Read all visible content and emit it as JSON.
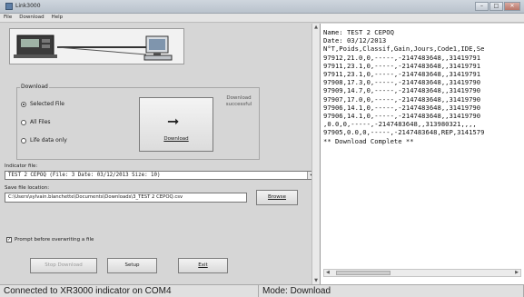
{
  "window": {
    "title": "Link3000",
    "minimize": "–",
    "maximize": "□",
    "close": "✕"
  },
  "menu": [
    "File",
    "Download",
    "Help"
  ],
  "download_group": {
    "title": "Download",
    "options": [
      {
        "label": "Selected File",
        "selected": true
      },
      {
        "label": "All Files",
        "selected": false
      },
      {
        "label": "Life data only",
        "selected": false
      }
    ],
    "button_label": "Download",
    "button_arrow": "➞",
    "status": "Download successful"
  },
  "indicator_file": {
    "label": "Indicator file:",
    "value": "TEST 2 CEPOQ          (File: 3  Date: 03/12/2013 Size: 10)",
    "dropdown_arrow": "▾"
  },
  "save_location": {
    "label": "Save file location:",
    "value": "C:\\Users\\sylvain.blanchette\\Documents\\Downloads\\3_TEST 2 CEPOQ.csv",
    "browse_label": "Browse"
  },
  "prompt_overwrite": {
    "label": "Prompt before overwriting a file",
    "checked": true,
    "check_mark": "✓"
  },
  "bottom_buttons": {
    "stop": "Stop Download",
    "setup": "Setup",
    "exit": "Exit"
  },
  "log_lines": [
    "Name: TEST 2 CEPOQ",
    "Date: 03/12/2013",
    "N°T,Poids,Classif,Gain,Jours,Code1,IDE,Se",
    "97912,21.0,0,-----,-2147483648,,31419791",
    "97911,23.1,0,-----,-2147483648,,31419791",
    "97911,23.1,0,-----,-2147483648,,31419791",
    "97908,17.3,0,-----,-2147483648,,31419790",
    "97909,14.7,0,-----,-2147483648,,31419790",
    "97907,17.0,0,-----,-2147483648,,31419790",
    "97906,14.1,0,-----,-2147483648,,31419790",
    "97906,14.1,0,-----,-2147483648,,31419790",
    ",0.0,0,-----,-2147483648,,313980321,,,,",
    "97905,0.0,0,-----,-2147483648,REP,3141579",
    "** Download Complete **"
  ],
  "scroll": {
    "up": "▲",
    "down": "▼",
    "left": "◀",
    "right": "▶"
  },
  "status_bar": {
    "connection": "Connected to XR3000 indicator on COM4",
    "mode": "Mode: Download"
  }
}
